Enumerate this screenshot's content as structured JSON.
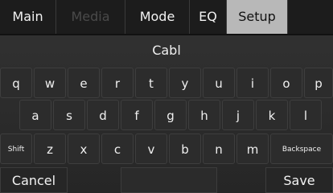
{
  "tabs": [
    {
      "label": "Main",
      "state": "normal"
    },
    {
      "label": "Media",
      "state": "disabled"
    },
    {
      "label": "Mode",
      "state": "normal"
    },
    {
      "label": "EQ",
      "state": "normal"
    },
    {
      "label": "Setup",
      "state": "active"
    }
  ],
  "input": {
    "value": "Cabl"
  },
  "keyboard": {
    "row1": [
      "q",
      "w",
      "e",
      "r",
      "t",
      "y",
      "u",
      "i",
      "o",
      "p"
    ],
    "row2": [
      "a",
      "s",
      "d",
      "f",
      "g",
      "h",
      "j",
      "k",
      "l"
    ],
    "row3": [
      "Shift",
      "z",
      "x",
      "c",
      "v",
      "b",
      "n",
      "m",
      "Backspace"
    ]
  },
  "actions": {
    "cancel": "Cancel",
    "save": "Save"
  }
}
